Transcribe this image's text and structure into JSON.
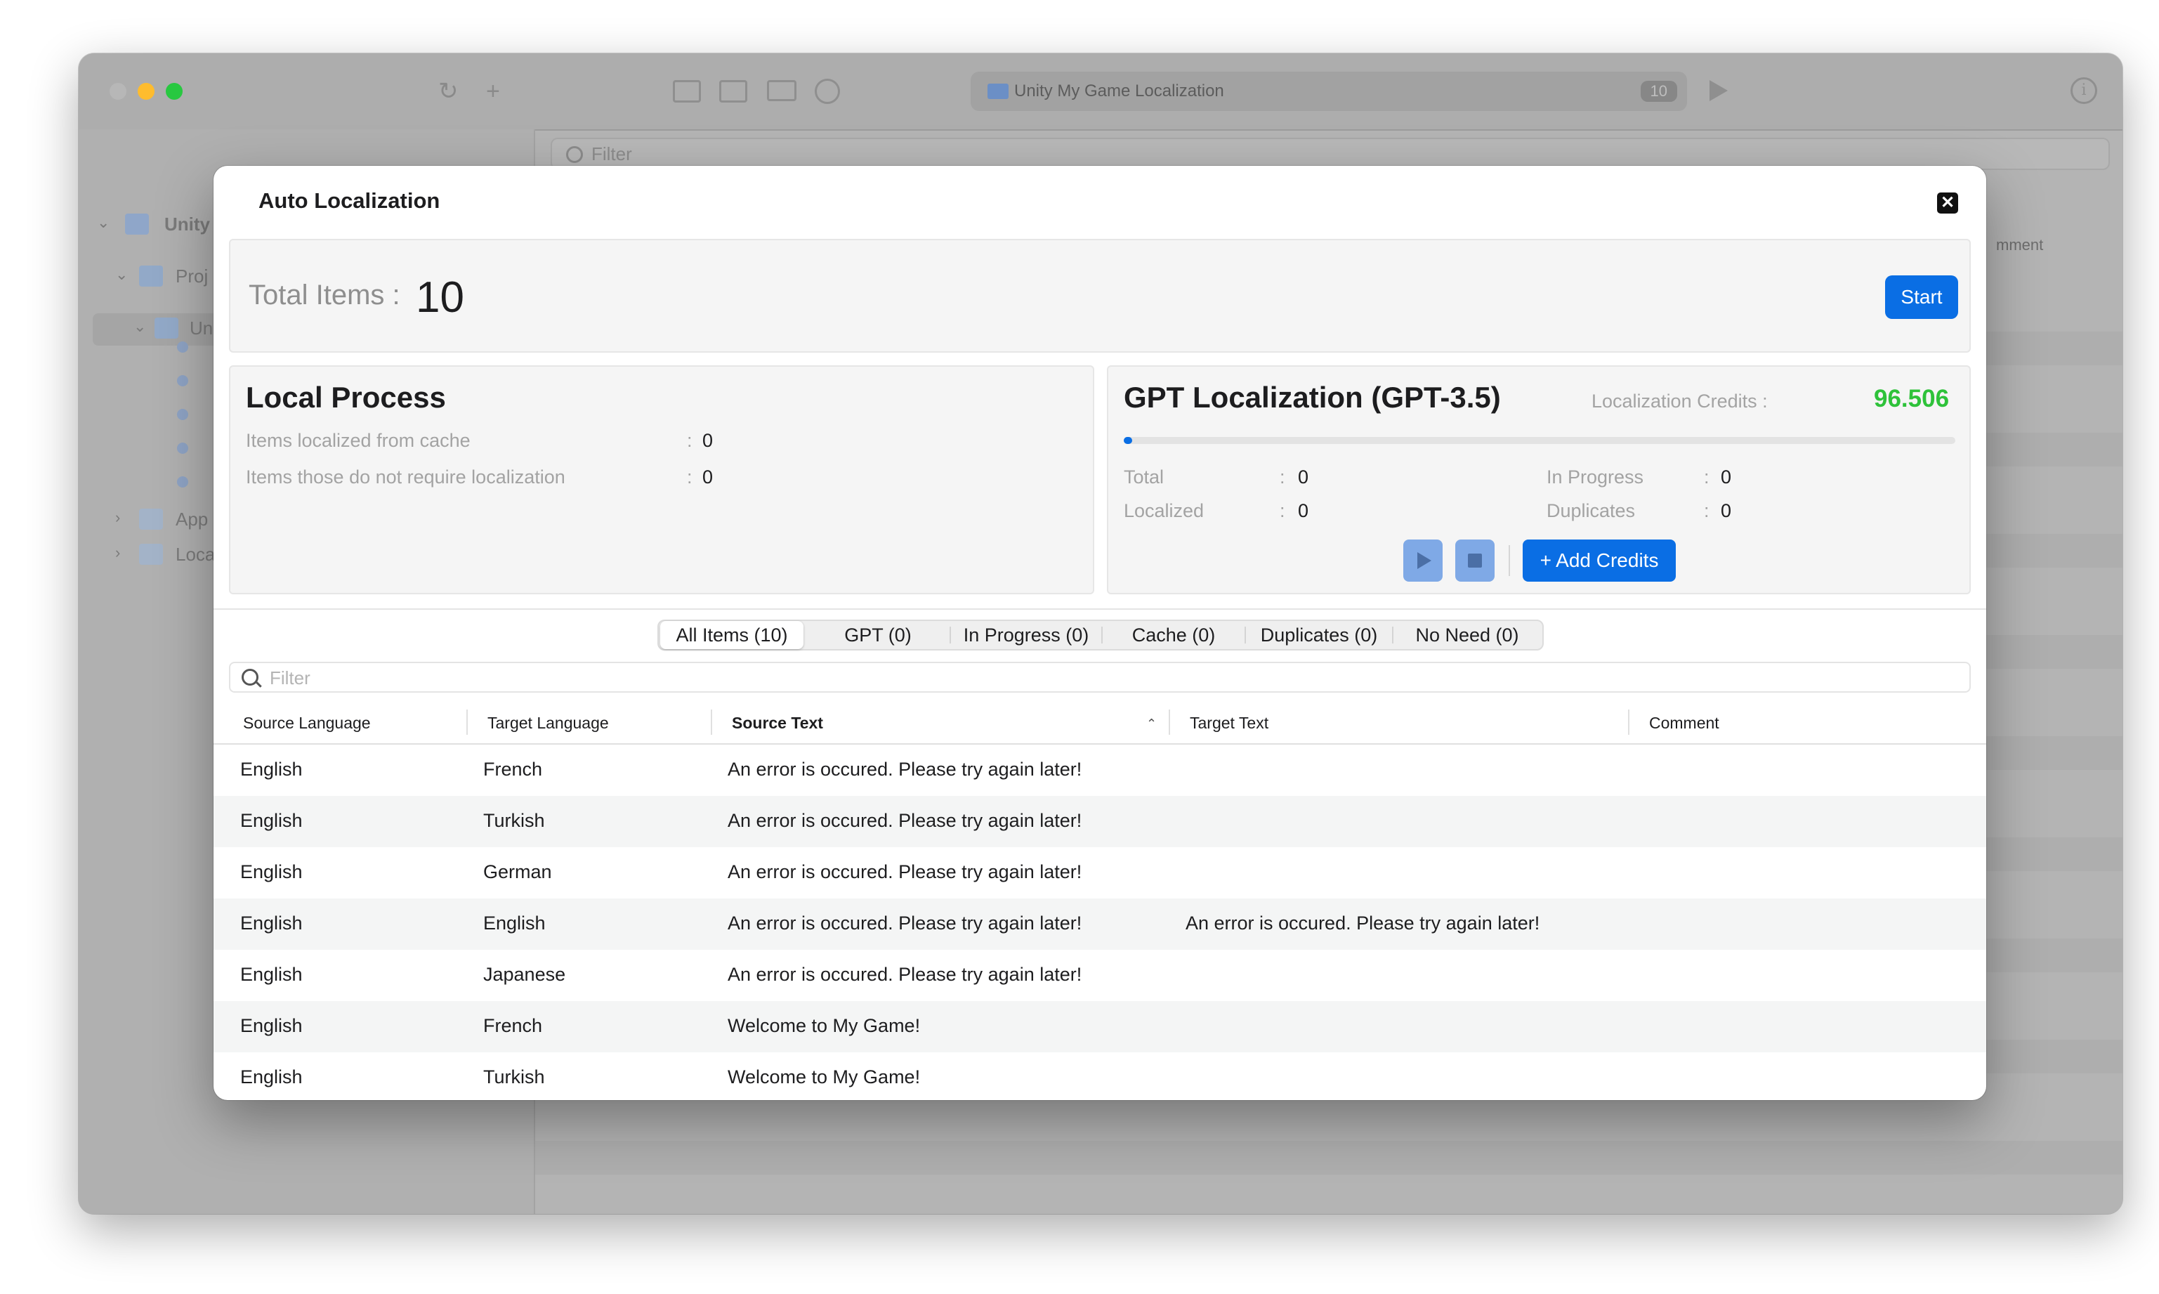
{
  "window": {
    "address_title": "Unity My Game Localization",
    "address_badge": "10",
    "bg_filter_placeholder": "Filter",
    "bg_comment_header": "mment",
    "sidebar": {
      "root_label": "Unity",
      "items": [
        "Proj",
        "Un",
        "App",
        "Loca"
      ]
    }
  },
  "modal": {
    "title": "Auto Localization",
    "close_icon": "close-icon",
    "total_label": "Total Items :",
    "total_value": "10",
    "start_label": "Start",
    "local": {
      "title": "Local Process",
      "rows": [
        {
          "label": "Items localized from cache",
          "value": "0"
        },
        {
          "label": "Items those do not require localization",
          "value": "0"
        }
      ]
    },
    "gpt": {
      "title": "GPT Localization (GPT-3.5)",
      "credits_label": "Localization Credits :",
      "credits_value": "96.506",
      "credits_color": "#2ec23a",
      "progress": 0,
      "stats": {
        "total": {
          "label": "Total",
          "value": "0"
        },
        "in_progress": {
          "label": "In Progress",
          "value": "0"
        },
        "localized": {
          "label": "Localized",
          "value": "0"
        },
        "duplicates": {
          "label": "Duplicates",
          "value": "0"
        }
      },
      "add_credits_label": "+ Add Credits"
    },
    "tabs": [
      "All Items (10)",
      "GPT (0)",
      "In Progress (0)",
      "Cache (0)",
      "Duplicates (0)",
      "No Need (0)"
    ],
    "selected_tab": 0,
    "filter_placeholder": "Filter",
    "table": {
      "columns": [
        "Source Language",
        "Target Language",
        "Source Text",
        "Target Text",
        "Comment"
      ],
      "sorted_column": "Source Text",
      "rows": [
        [
          "English",
          "French",
          "An error is occured. Please try again later!",
          "",
          ""
        ],
        [
          "English",
          "Turkish",
          "An error is occured. Please try again later!",
          "",
          ""
        ],
        [
          "English",
          "German",
          "An error is occured. Please try again later!",
          "",
          ""
        ],
        [
          "English",
          "English",
          "An error is occured. Please try again later!",
          "An error is occured. Please try again later!",
          ""
        ],
        [
          "English",
          "Japanese",
          "An error is occured. Please try again later!",
          "",
          ""
        ],
        [
          "English",
          "French",
          "Welcome to My Game!",
          "",
          ""
        ],
        [
          "English",
          "Turkish",
          "Welcome to My Game!",
          "",
          ""
        ]
      ]
    },
    "accent_color": "#0a6ee4"
  }
}
